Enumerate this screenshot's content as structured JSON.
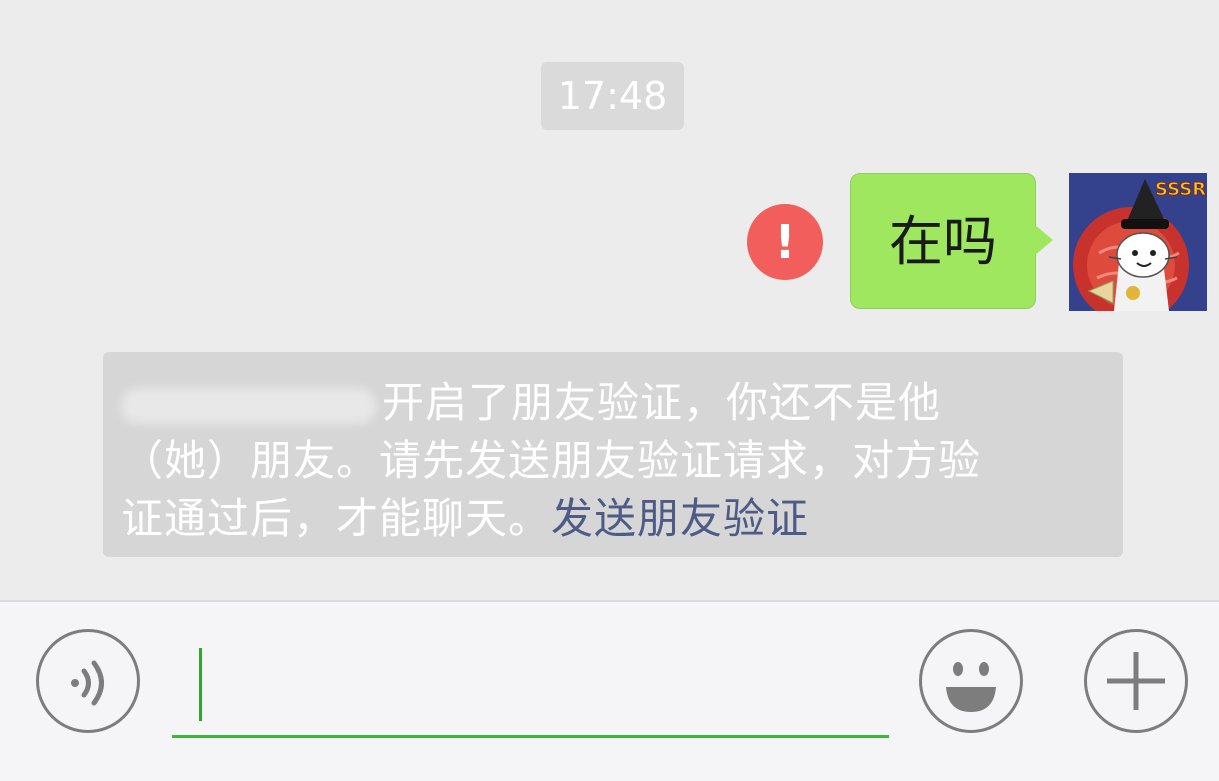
{
  "chat": {
    "timestamp": "17:48",
    "messages": [
      {
        "direction": "outgoing",
        "text": "在吗",
        "status": "failed",
        "status_icon": "!"
      }
    ],
    "avatar": {
      "icon": "cartoon-cat-avatar",
      "badge_text": "SSSR"
    },
    "notice": {
      "line1": "开启了朋友验证，你还不是他",
      "line2": "（她）朋友。请先发送朋友验证请求，对方验",
      "line3": "证通过后，才能聊天。",
      "link": "发送朋友验证"
    }
  },
  "input_bar": {
    "voice_icon": "voice-icon",
    "text_value": "",
    "emoji_icon": "emoji-icon",
    "plus_icon": "plus-icon"
  },
  "colors": {
    "background": "#ececec",
    "bubble": "#9fe75f",
    "error": "#f15e5c",
    "link": "#4f5b87",
    "input_underline": "#3fb73b"
  }
}
